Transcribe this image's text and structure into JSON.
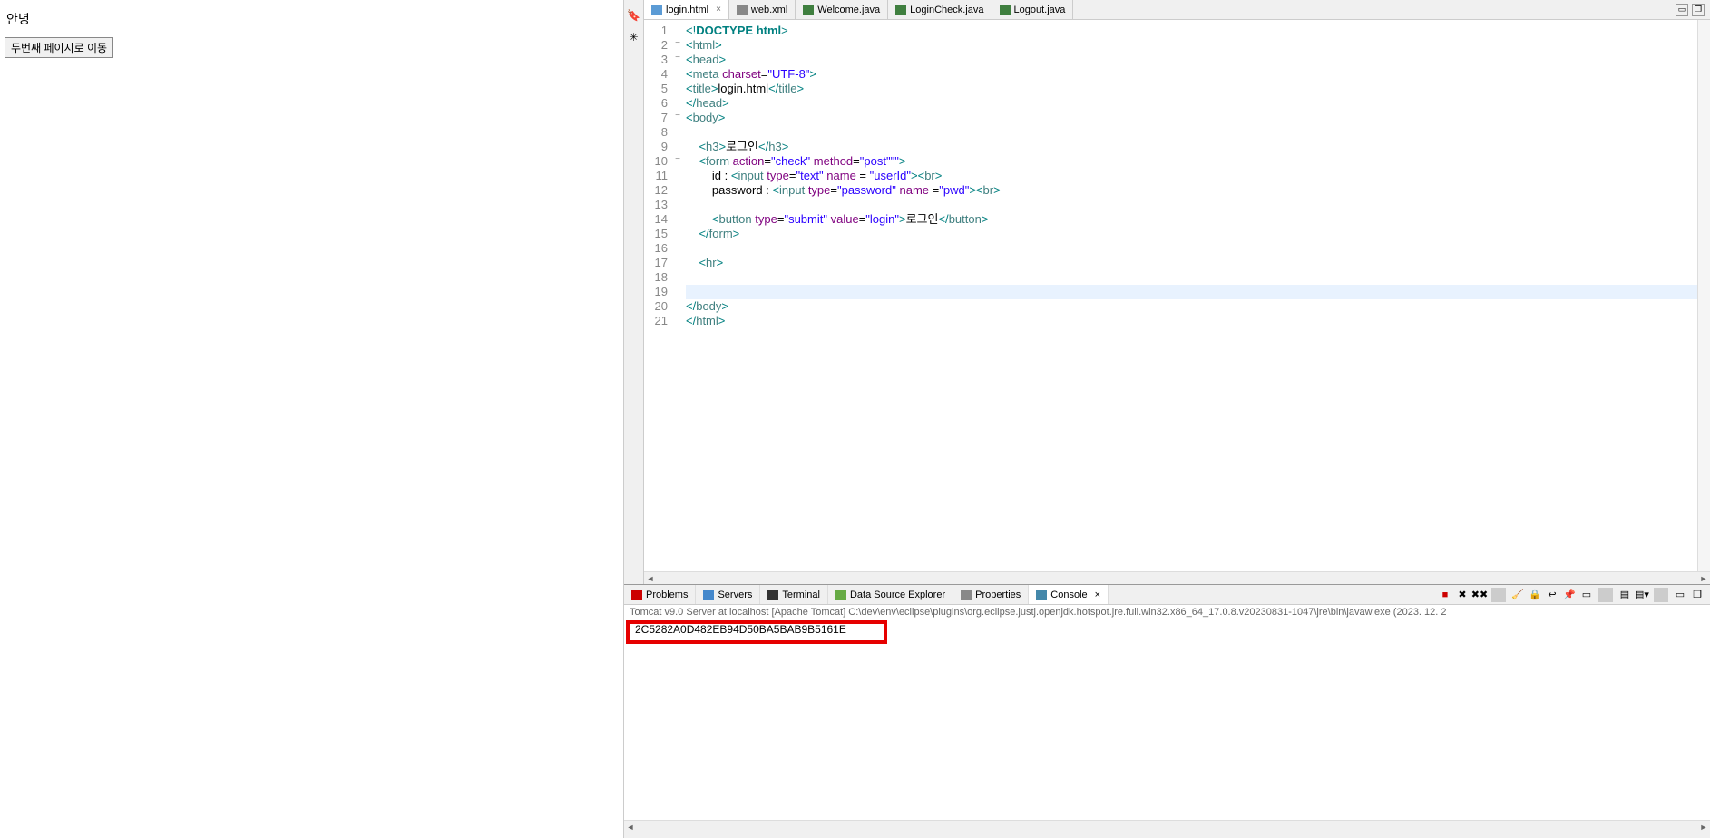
{
  "leftPane": {
    "greeting": "안녕",
    "navButton": "두번째 페이지로 이동"
  },
  "editorTabs": [
    {
      "name": "login.html",
      "icon": "html",
      "active": true
    },
    {
      "name": "web.xml",
      "icon": "xml",
      "active": false
    },
    {
      "name": "Welcome.java",
      "icon": "java",
      "active": false
    },
    {
      "name": "LoginCheck.java",
      "icon": "java",
      "active": false
    },
    {
      "name": "Logout.java",
      "icon": "java",
      "active": false
    }
  ],
  "code": {
    "lines": [
      {
        "n": "1",
        "fold": "",
        "html": "<span class='bracket'>&lt;!</span><span class='doctype'>DOCTYPE</span> <span class='doctype'>html</span><span class='bracket'>&gt;</span>"
      },
      {
        "n": "2",
        "fold": "−",
        "html": "<span class='bracket'>&lt;</span><span class='tagname'>html</span><span class='bracket'>&gt;</span>"
      },
      {
        "n": "3",
        "fold": "−",
        "html": "<span class='bracket'>&lt;</span><span class='tagname'>head</span><span class='bracket'>&gt;</span>"
      },
      {
        "n": "4",
        "fold": "",
        "html": "<span class='bracket'>&lt;</span><span class='tagname'>meta</span> <span class='attr'>charset</span>=<span class='string'>\"UTF-8\"</span><span class='bracket'>&gt;</span>"
      },
      {
        "n": "5",
        "fold": "",
        "html": "<span class='bracket'>&lt;</span><span class='tagname'>title</span><span class='bracket'>&gt;</span><span class='text'>login.html</span><span class='bracket'>&lt;/</span><span class='tagname'>title</span><span class='bracket'>&gt;</span>"
      },
      {
        "n": "6",
        "fold": "",
        "html": "<span class='bracket'>&lt;/</span><span class='tagname'>head</span><span class='bracket'>&gt;</span>"
      },
      {
        "n": "7",
        "fold": "−",
        "html": "<span class='bracket'>&lt;</span><span class='tagname'>body</span><span class='bracket'>&gt;</span>"
      },
      {
        "n": "8",
        "fold": "",
        "html": ""
      },
      {
        "n": "9",
        "fold": "",
        "html": "    <span class='bracket'>&lt;</span><span class='tagname'>h3</span><span class='bracket'>&gt;</span><span class='text'>로그인</span><span class='bracket'>&lt;/</span><span class='tagname'>h3</span><span class='bracket'>&gt;</span>"
      },
      {
        "n": "10",
        "fold": "−",
        "html": "    <span class='bracket'>&lt;</span><span class='tagname'>form</span> <span class='attr'>action</span>=<span class='string'>\"check\"</span> <span class='attr'>method</span>=<span class='string'>\"post\"</span><span class='string'>\"\"</span><span class='bracket'>&gt;</span>"
      },
      {
        "n": "11",
        "fold": "",
        "html": "        <span class='text'>id : </span><span class='bracket'>&lt;</span><span class='tagname'>input</span> <span class='attr'>type</span>=<span class='string'>\"text\"</span> <span class='attr'>name</span> = <span class='string'>\"userId\"</span><span class='bracket'>&gt;&lt;</span><span class='tagname'>br</span><span class='bracket'>&gt;</span>"
      },
      {
        "n": "12",
        "fold": "",
        "html": "        <span class='text'>password : </span><span class='bracket'>&lt;</span><span class='tagname'>input</span> <span class='attr'>type</span>=<span class='string'>\"password\"</span> <span class='attr'>name</span> =<span class='string'>\"pwd\"</span><span class='bracket'>&gt;&lt;</span><span class='tagname'>br</span><span class='bracket'>&gt;</span>"
      },
      {
        "n": "13",
        "fold": "",
        "html": ""
      },
      {
        "n": "14",
        "fold": "",
        "html": "        <span class='bracket'>&lt;</span><span class='tagname'>button</span> <span class='attr'>type</span>=<span class='string'>\"submit\"</span> <span class='attr'>value</span>=<span class='string'>\"login\"</span><span class='bracket'>&gt;</span><span class='text'>로그인</span><span class='bracket'>&lt;/</span><span class='tagname'>button</span><span class='bracket'>&gt;</span>"
      },
      {
        "n": "15",
        "fold": "",
        "html": "    <span class='bracket'>&lt;/</span><span class='tagname'>form</span><span class='bracket'>&gt;</span>"
      },
      {
        "n": "16",
        "fold": "",
        "html": ""
      },
      {
        "n": "17",
        "fold": "",
        "html": "    <span class='bracket'>&lt;</span><span class='tagname'>hr</span><span class='bracket'>&gt;</span>"
      },
      {
        "n": "18",
        "fold": "",
        "html": ""
      },
      {
        "n": "19",
        "fold": "",
        "html": "",
        "current": true
      },
      {
        "n": "20",
        "fold": "",
        "html": "<span class='bracket'>&lt;/</span><span class='tagname'>body</span><span class='bracket'>&gt;</span>"
      },
      {
        "n": "21",
        "fold": "",
        "html": "<span class='bracket'>&lt;/</span><span class='tagname'>html</span><span class='bracket'>&gt;</span>"
      }
    ]
  },
  "bottomTabs": [
    {
      "name": "Problems",
      "icon": "prob"
    },
    {
      "name": "Servers",
      "icon": "serv"
    },
    {
      "name": "Terminal",
      "icon": "term"
    },
    {
      "name": "Data Source Explorer",
      "icon": "dse"
    },
    {
      "name": "Properties",
      "icon": "prop"
    },
    {
      "name": "Console",
      "icon": "cons",
      "active": true,
      "closable": true
    }
  ],
  "console": {
    "header": "Tomcat v9.0 Server at localhost [Apache Tomcat] C:\\dev\\env\\eclipse\\plugins\\org.eclipse.justj.openjdk.hotspot.jre.full.win32.x86_64_17.0.8.v20230831-1047\\jre\\bin\\javaw.exe  (2023. 12. 2",
    "line1": "2C5282A0D482EB94D50BA5BAB9B5161E"
  }
}
